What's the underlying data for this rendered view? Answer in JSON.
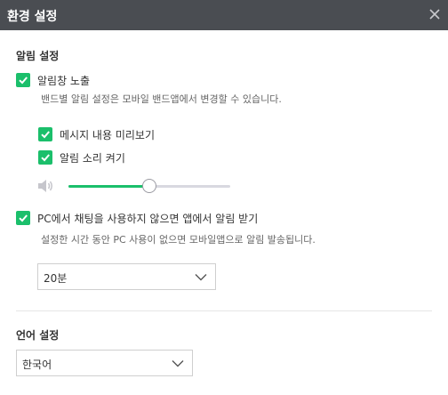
{
  "window": {
    "title": "환경 설정"
  },
  "notification": {
    "section_title": "알림 설정",
    "show_popup": {
      "label": "알림창 노출",
      "checked": true
    },
    "band_note": "밴드별 알림 설정은 모바일 밴드앱에서 변경할 수 있습니다.",
    "message_preview": {
      "label": "메시지 내용 미리보기",
      "checked": true
    },
    "sound": {
      "label": "알림 소리 켜기",
      "checked": true
    },
    "volume": {
      "level": 0.5
    },
    "pc_idle": {
      "label": "PC에서 채팅을 사용하지 않으면 앱에서 알림 받기",
      "checked": true
    },
    "pc_idle_note": "설정한 시간 동안 PC 사용이 없으면 모바일앱으로 알림 발송됩니다.",
    "idle_time": {
      "selected": "20분"
    }
  },
  "language": {
    "section_title": "언어 설정",
    "selected": "한국어"
  },
  "colors": {
    "accent": "#1bbf6b",
    "titlebar": "#4a4d52"
  },
  "icons": {
    "close": "close-icon",
    "check": "check-icon",
    "volume": "speaker-icon",
    "dropdown": "chevron-down-icon"
  }
}
